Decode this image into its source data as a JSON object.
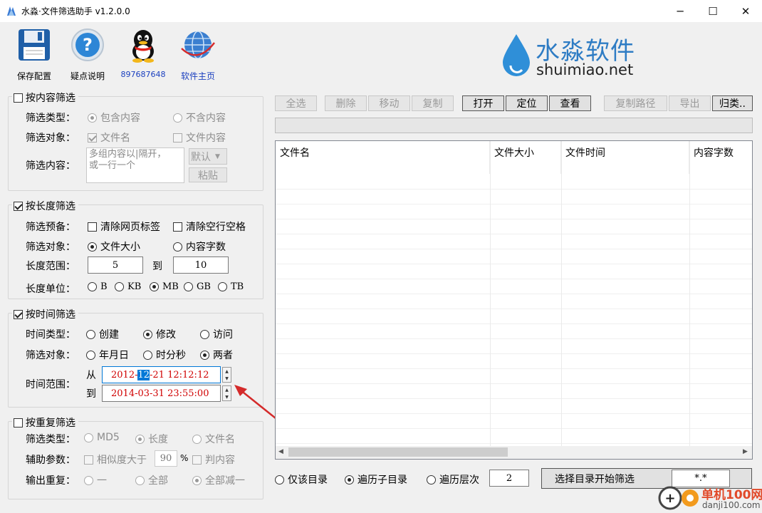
{
  "window": {
    "title": "水淼·文件筛选助手 v1.2.0.0",
    "min": "─",
    "max": "☐",
    "close": "✕"
  },
  "toolbar": {
    "save": "保存配置",
    "help": "疑点说明",
    "qq": "897687648",
    "home": "软件主页"
  },
  "brand": {
    "cn": "水淼软件",
    "en": "shuimiao.net"
  },
  "content_filter": {
    "title": "按内容筛选",
    "type_label": "筛选类型：",
    "type_opts": [
      "包含内容",
      "不含内容"
    ],
    "target_label": "筛选对象：",
    "target_opts": [
      "文件名",
      "文件内容"
    ],
    "content_label": "筛选内容：",
    "placeholder": "多组内容以|隔开，\n或一行一个",
    "default_btn": "默认",
    "paste_btn": "粘贴"
  },
  "length_filter": {
    "title": "按长度筛选",
    "prep_label": "筛选预备：",
    "prep_opts": [
      "清除网页标签",
      "清除空行空格"
    ],
    "target_label": "筛选对象：",
    "target_opts": [
      "文件大小",
      "内容字数"
    ],
    "range_label": "长度范围：",
    "from": "5",
    "to_word": "到",
    "to": "10",
    "unit_label": "长度单位：",
    "units": [
      "B",
      "KB",
      "MB",
      "GB",
      "TB"
    ]
  },
  "time_filter": {
    "title": "按时间筛选",
    "type_label": "时间类型：",
    "type_opts": [
      "创建",
      "修改",
      "访问"
    ],
    "target_label": "筛选对象：",
    "target_opts": [
      "年月日",
      "时分秒",
      "两者"
    ],
    "range_label": "时间范围：",
    "from_word": "从",
    "from_pre": "2012-",
    "from_sel": "12",
    "from_post": "-21 12:12:12",
    "to_word": "到",
    "to_value": "2014-03-31 23:55:00"
  },
  "dup_filter": {
    "title": "按重复筛选",
    "type_label": "筛选类型：",
    "type_opts": [
      "MD5",
      "长度",
      "文件名"
    ],
    "aux_label": "辅助参数：",
    "sim_label": "相似度大于",
    "sim_value": "90",
    "pct": "%",
    "judge": "判内容",
    "out_label": "输出重复：",
    "out_opts": [
      "一",
      "全部",
      "全部减一"
    ]
  },
  "actions": {
    "select_all": "全选",
    "delete": "删除",
    "move": "移动",
    "copy": "复制",
    "open": "打开",
    "locate": "定位",
    "view": "查看",
    "copy_path": "复制路径",
    "export": "导出",
    "classify": "归类.."
  },
  "table": {
    "headers": [
      "文件名",
      "文件大小",
      "文件时间",
      "内容字数"
    ]
  },
  "bottom": {
    "scope_opts": [
      "仅该目录",
      "遍历子目录",
      "遍历层次"
    ],
    "depth": "2",
    "start": "选择目录开始筛选",
    "pattern": "*.*"
  },
  "watermark": {
    "cn": "单机100网",
    "en": "danji100.com"
  },
  "colors": {
    "date_red": "#d00000",
    "sel_blue": "#0078d7"
  }
}
